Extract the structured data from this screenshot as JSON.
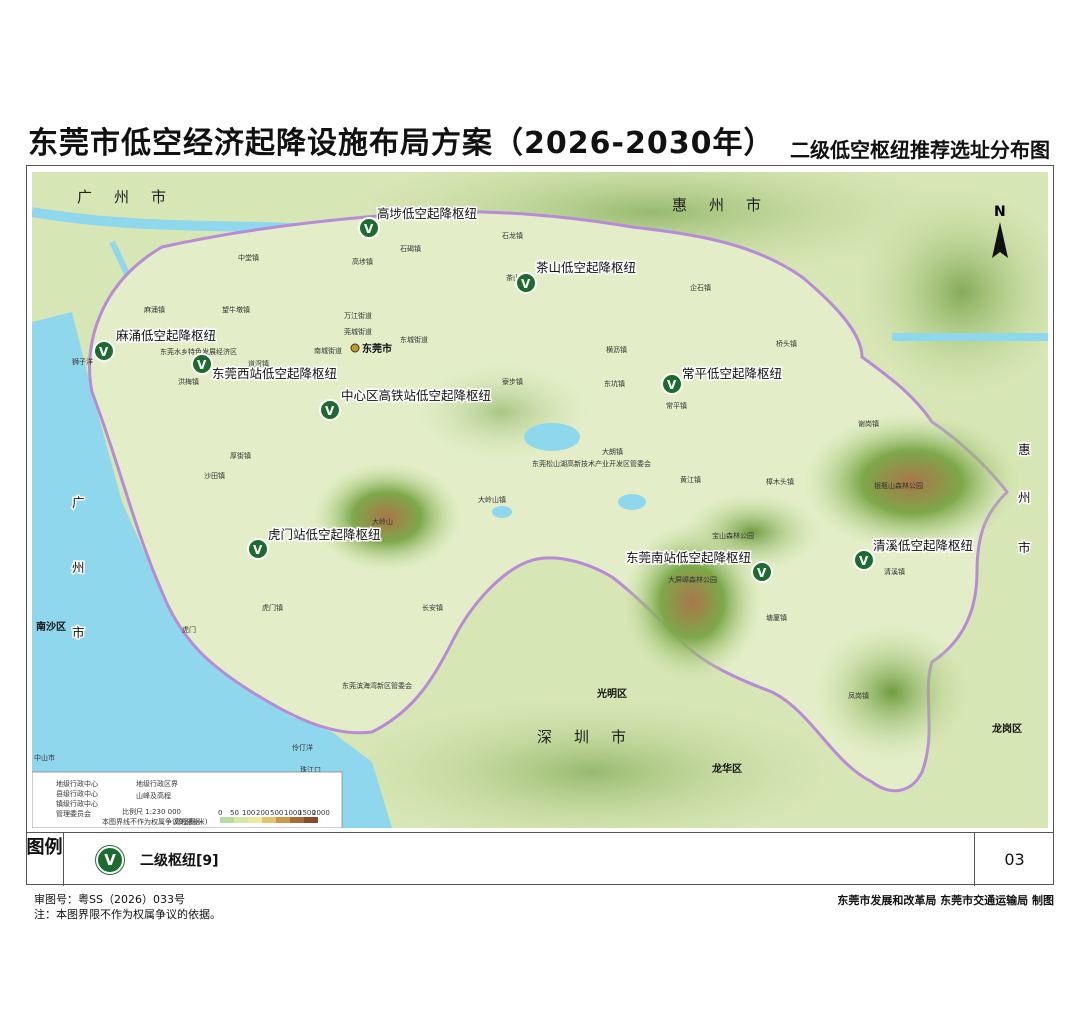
{
  "header": {
    "title": "东莞市低空经济起降设施布局方案（2026-2030年）",
    "subtitle": "二级低空枢纽推荐选址分布图"
  },
  "map": {
    "north_label": "N",
    "capital_label": "东莞市",
    "hub_symbol": "V",
    "hubs": [
      {
        "name": "高埗低空起降枢纽"
      },
      {
        "name": "茶山低空起降枢纽"
      },
      {
        "name": "麻涌低空起降枢纽"
      },
      {
        "name": "东莞西站低空起降枢纽"
      },
      {
        "name": "中心区高铁站低空起降枢纽"
      },
      {
        "name": "常平低空起降枢纽"
      },
      {
        "name": "虎门站低空起降枢纽"
      },
      {
        "name": "东莞南站低空起降枢纽"
      },
      {
        "name": "清溪低空起降枢纽"
      }
    ],
    "neighbors": {
      "guangzhou_top": "广州市",
      "huizhou_top": "惠州市",
      "huizhou_right": "惠州市",
      "guangzhou_left": "广州市",
      "shenzhen": "深圳市",
      "zhongshan": "中山市"
    },
    "districts": {
      "nansha": "南沙区",
      "guangming": "光明区",
      "longhua": "龙华区",
      "longgang": "龙岗区"
    },
    "towns": [
      "中堂镇",
      "高埗镇",
      "石碣镇",
      "石龙镇",
      "茶山镇",
      "企石镇",
      "麻涌镇",
      "望牛墩镇",
      "万江街道",
      "莞城街道",
      "东城街道",
      "南城街道",
      "道滘镇",
      "洪梅镇",
      "寮步镇",
      "横沥镇",
      "东坑镇",
      "常平镇",
      "桥头镇",
      "谢岗镇",
      "大朗镇",
      "黄江镇",
      "樟木头镇",
      "清溪镇",
      "塘厦镇",
      "凤岗镇",
      "厚街镇",
      "沙田镇",
      "大岭山镇",
      "虎门镇",
      "长安镇",
      "东莞滨海湾新区管委会",
      "东莞松山湖高新技术产业开发区管委会",
      "东莞水乡特色发展经济区"
    ],
    "parks": [
      "大岭山",
      "大屏嶂森林公园",
      "银瓶山森林公园",
      "宝山森林公园"
    ],
    "water": [
      "狮子洋",
      "伶仃洋",
      "珠江口",
      "虎门"
    ],
    "legend_inset": {
      "items": [
        "地级行政中心",
        "县级行政中心",
        "镇级行政中心",
        "管理委员会",
        "地级行政区界",
        "山峰及高程"
      ],
      "scale": "比例尺    1:230 000",
      "note": "本图界线不作为权属争议的依据",
      "elevation_label": "高程表(米)",
      "elevation_ticks": [
        "0",
        "50",
        "100",
        "200",
        "500",
        "1000",
        "1500",
        "2000"
      ]
    }
  },
  "legend": {
    "label": "图例",
    "item": "二级枢纽[9]",
    "page_number": "03"
  },
  "footer": {
    "approval": "审图号：粤SS（2026）033号",
    "note": "注：本图界限不作为权属争议的依据。",
    "publisher": "东莞市发展和改革局  东莞市交通运输局 制图"
  },
  "colors": {
    "hub_green": "#1e6b30",
    "water": "#8fd7ec",
    "land": "#dce9bd",
    "boundary": "#b88bd6"
  }
}
